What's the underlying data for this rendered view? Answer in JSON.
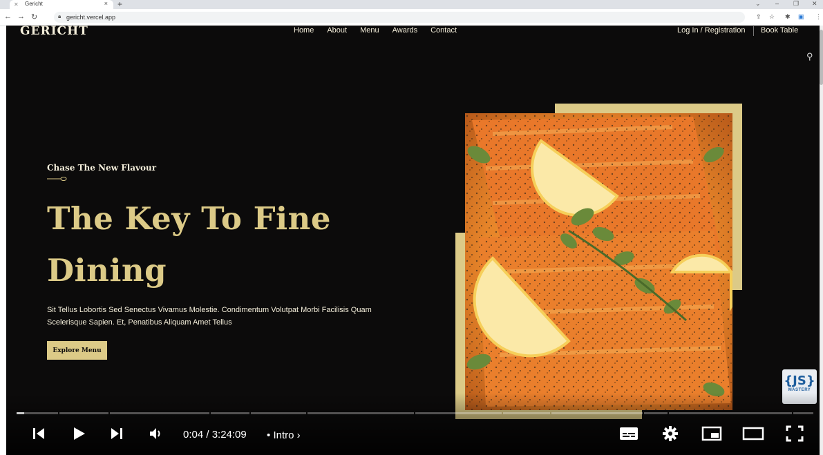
{
  "browser": {
    "tab_title": "Gericht",
    "url": "gericht.vercel.app"
  },
  "site": {
    "logo": "GERICHT",
    "nav": [
      "Home",
      "About",
      "Menu",
      "Awards",
      "Contact"
    ],
    "login": "Log In / Registration",
    "book": "Book Table",
    "subtitle": "Chase The New Flavour",
    "headline_line1": "The Key To Fine",
    "headline_line2": "Dining",
    "paragraph": "Sit Tellus Lobortis Sed Senectus Vivamus Molestie. Condimentum Volutpat Morbi Facilisis Quam Scelerisque Sapien. Et, Penatibus Aliquam Amet Tellus",
    "cta": "Explore Menu"
  },
  "badge": {
    "braces": "{JS}",
    "label": "MASTERY"
  },
  "player": {
    "time": "0:04 / 3:24:09",
    "chapter": "Intro",
    "progress_fraction": 0.0003
  }
}
